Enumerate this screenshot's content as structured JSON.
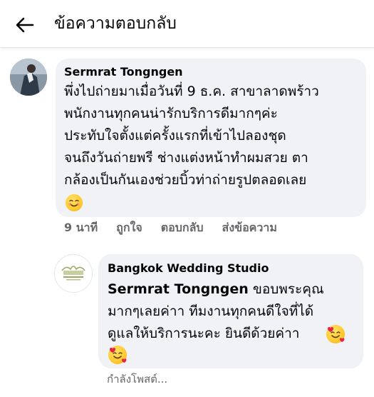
{
  "header": {
    "title": "ข้อความตอบกลับ"
  },
  "comment": {
    "author": "Sermrat Tongngen",
    "lines": [
      "พึ่งไปถ่ายมาเมื่อวันที่ 9 ธ.ค. สาขาลาดพร้าว",
      "พนักงานทุกคนน่ารักบริการดีมากๆค่ะ",
      "ประทับใจตั้งแต่ครั้งแรกที่เข้าไปลองชุด",
      "จนถึงวันถ่ายพรี ช่างแต่งหน้าทำผมสวย ตา",
      "กล้องเป็นกันเองช่วยบิ้วท่าถ่ายรูปตลอดเลย"
    ],
    "emoji": "smiling-face-icon",
    "time": "9 นาที",
    "like_label": "ถูกใจ",
    "reply_label": "ตอบกลับ",
    "message_label": "ส่งข้อความ"
  },
  "reply": {
    "author": "Bangkok Wedding Studio",
    "mention": "Sermrat Tongngen",
    "line1_rest": " ขอบพระคุณ",
    "line2": "มากๆเลยค่าา ทีมงานทุกคนดีใจที่ได้",
    "line3": "ดูแลให้บริการนะคะ ยินดีด้วยค่าา",
    "emoji": "smiling-face-with-hearts-icon",
    "status": "กำลังโพสต์..."
  },
  "colors": {
    "bubble": "#f0f2f5",
    "meta_text": "#65676b",
    "primary_text": "#050505"
  }
}
